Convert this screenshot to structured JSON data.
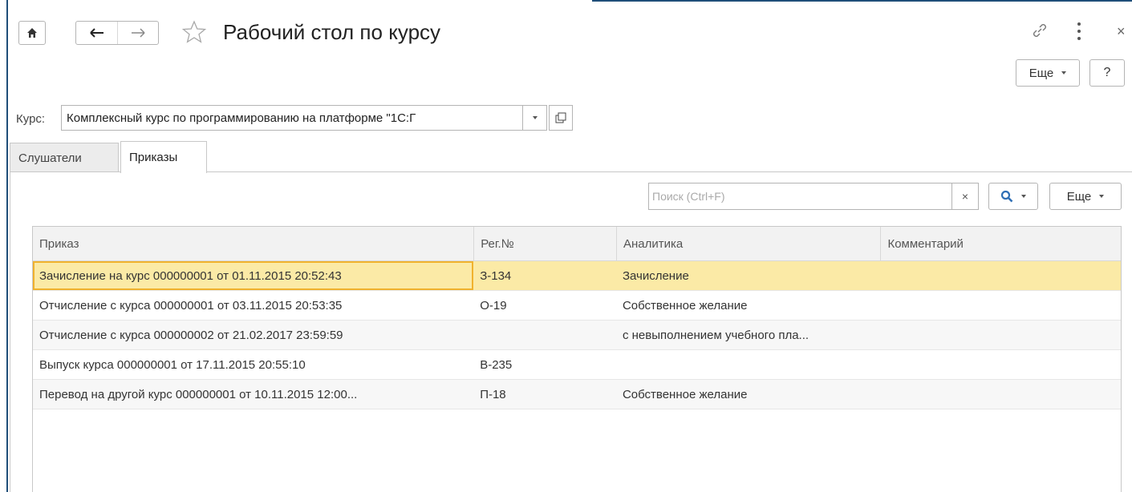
{
  "window": {
    "title": "Рабочий стол по курсу",
    "more_label": "Еще",
    "help_label": "?"
  },
  "course": {
    "label": "Курс:",
    "value": "Комплексный курс по программированию на платформе \"1С:Г"
  },
  "tabs": [
    {
      "label": "Слушатели",
      "active": false
    },
    {
      "label": "Приказы",
      "active": true
    }
  ],
  "search": {
    "placeholder": "Поиск (Ctrl+F)",
    "clear_label": "×",
    "more_label": "Еще"
  },
  "table": {
    "columns": [
      "Приказ",
      "Рег.№",
      "Аналитика",
      "Комментарий"
    ],
    "rows": [
      [
        "Зачисление на курс 000000001 от 01.11.2015 20:52:43",
        "З-134",
        "Зачисление",
        ""
      ],
      [
        "Отчисление с курса 000000001 от 03.11.2015 20:53:35",
        "О-19",
        "Собственное желание",
        ""
      ],
      [
        "Отчисление с курса 000000002 от 21.02.2017 23:59:59",
        "",
        "с невыполнением учебного пла...",
        ""
      ],
      [
        "Выпуск курса 000000001 от 17.11.2015 20:55:10",
        "В-235",
        "",
        ""
      ],
      [
        "Перевод на другой курс 000000001 от 10.11.2015 12:00...",
        "П-18",
        "Собственное желание",
        ""
      ]
    ],
    "selected_row": 0
  },
  "colors": {
    "accent_frame": "#1f4e79",
    "selected_row": "#fbeaa6",
    "selected_border": "#f0b22e",
    "search_icon": "#2f6fb5"
  },
  "icons": {
    "home": "home-icon",
    "back": "arrow-left-icon",
    "forward": "arrow-right-icon",
    "favorite": "star-icon",
    "link": "link-icon",
    "menu": "kebab-icon",
    "close": "close-icon",
    "search": "search-icon",
    "open": "open-form-icon"
  }
}
